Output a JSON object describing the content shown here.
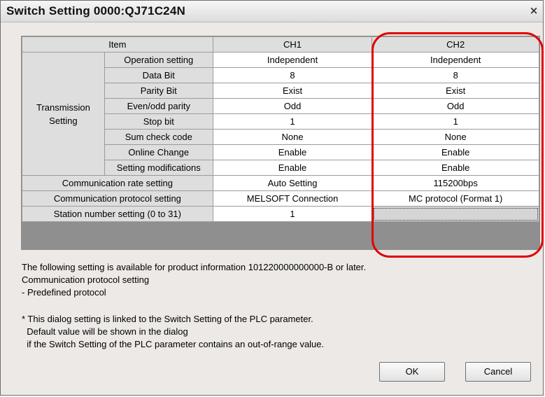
{
  "window": {
    "title": "Switch Setting 0000:QJ71C24N",
    "close_label": "×"
  },
  "grid": {
    "header": {
      "item": "Item",
      "ch1": "CH1",
      "ch2": "CH2"
    },
    "transmission_group": "Transmission\nSetting",
    "transmission_rows": [
      {
        "label": "Operation setting",
        "ch1": "Independent",
        "ch2": "Independent"
      },
      {
        "label": "Data Bit",
        "ch1": "8",
        "ch2": "8"
      },
      {
        "label": "Parity Bit",
        "ch1": "Exist",
        "ch2": "Exist"
      },
      {
        "label": "Even/odd parity",
        "ch1": "Odd",
        "ch2": "Odd"
      },
      {
        "label": "Stop bit",
        "ch1": "1",
        "ch2": "1"
      },
      {
        "label": "Sum check code",
        "ch1": "None",
        "ch2": "None"
      },
      {
        "label": "Online Change",
        "ch1": "Enable",
        "ch2": "Enable"
      },
      {
        "label": "Setting modifications",
        "ch1": "Enable",
        "ch2": "Enable"
      }
    ],
    "other_rows": [
      {
        "label": "Communication rate setting",
        "ch1": "Auto Setting",
        "ch2": "115200bps"
      },
      {
        "label": "Communication protocol setting",
        "ch1": "MELSOFT Connection",
        "ch2": "MC protocol (Format 1)"
      },
      {
        "label": "Station number setting (0 to 31)",
        "ch1": "1",
        "ch2": ""
      }
    ]
  },
  "info_lines": [
    "The following setting is available for product information 101220000000000-B or later.",
    "Communication protocol setting",
    "- Predefined protocol"
  ],
  "note_lines": [
    "* This dialog setting is linked to the Switch Setting of the PLC parameter.",
    "  Default value will be shown in the dialog",
    "  if the Switch Setting of the PLC parameter contains an out-of-range value."
  ],
  "buttons": {
    "ok": "OK",
    "cancel": "Cancel"
  },
  "colors": {
    "highlight": "#e00000",
    "header_bg": "#dedede",
    "grid_bg": "#8f8f8f"
  }
}
